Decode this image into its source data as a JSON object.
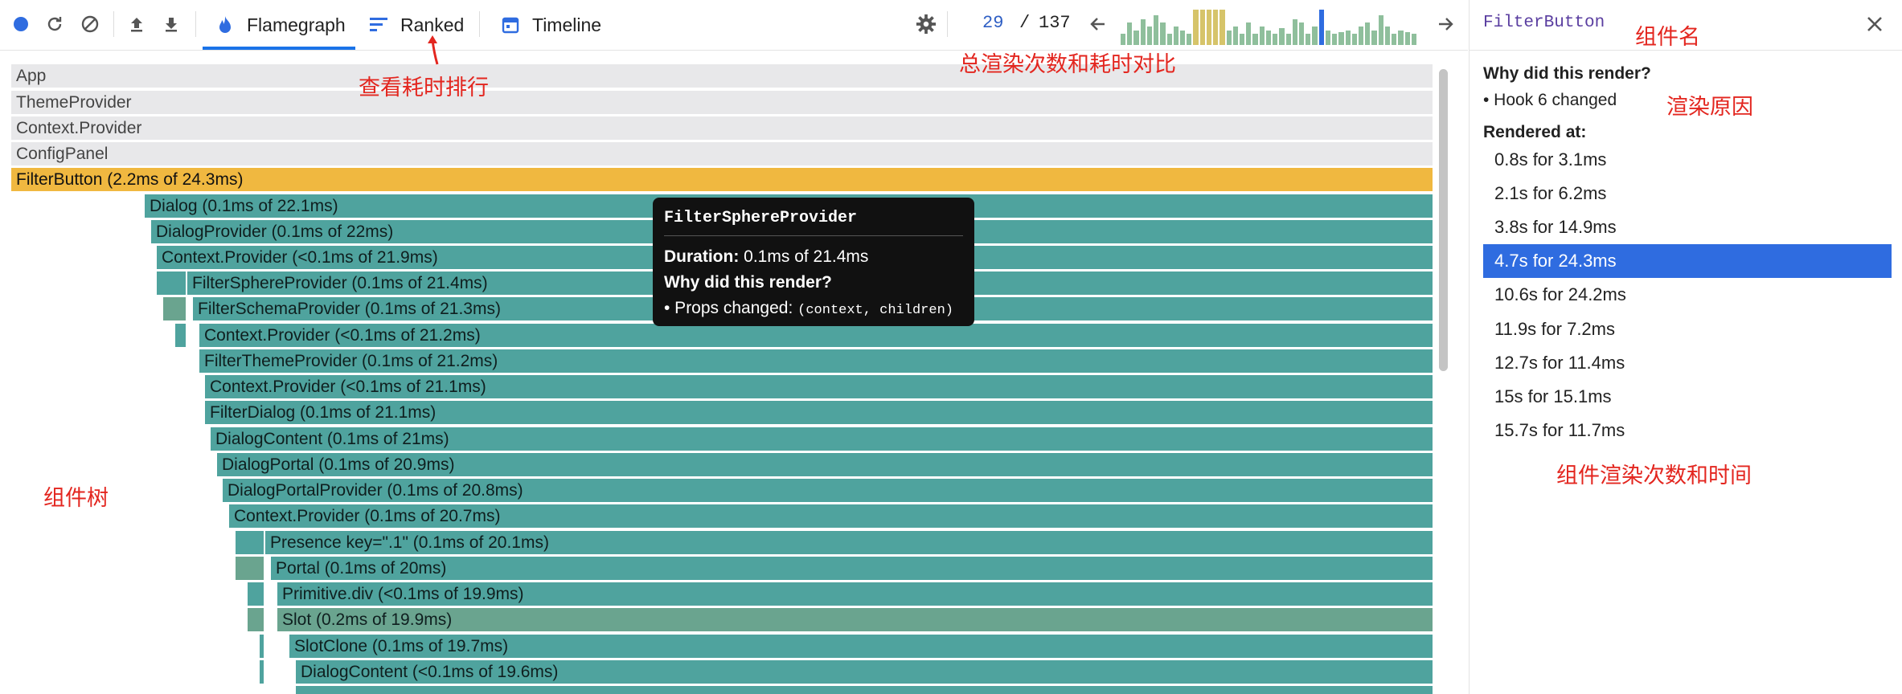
{
  "toolbar": {
    "icons": [
      "record-icon",
      "reload-icon",
      "clear-icon",
      "upload-icon",
      "download-icon"
    ],
    "tabs": [
      {
        "label": "Flamegraph",
        "icon": "flame-icon",
        "active": true
      },
      {
        "label": "Ranked",
        "icon": "ranked-icon",
        "active": false
      },
      {
        "label": "Timeline",
        "icon": "calendar-icon",
        "active": false
      }
    ],
    "settings_icon": "gear-icon",
    "commit_current": "29",
    "commit_separator": "/",
    "commit_total": "137",
    "prev_icon": "arrow-left-icon",
    "next_icon": "arrow-right-icon",
    "commit_heights": [
      0.3,
      0.6,
      0.4,
      0.7,
      0.5,
      0.8,
      0.6,
      0.3,
      0.5,
      0.4,
      0.3,
      0.95,
      0.95,
      0.95,
      0.95,
      0.95,
      0.4,
      0.5,
      0.3,
      0.6,
      0.3,
      0.5,
      0.4,
      0.3,
      0.45,
      0.3,
      0.7,
      0.6,
      0.3,
      0.5,
      0.95,
      0.4,
      0.3,
      0.35,
      0.4,
      0.3,
      0.5,
      0.6,
      0.4,
      0.8,
      0.5,
      0.3,
      0.4,
      0.35,
      0.3
    ],
    "commit_colors": {
      "normal": "#8fbf9c",
      "hot": "#d6c46a",
      "selected": "#2f6ce0"
    }
  },
  "flamegraph": {
    "rows": [
      {
        "label": "App",
        "style": "grey"
      },
      {
        "label": "ThemeProvider",
        "style": "grey"
      },
      {
        "label": "Context.Provider",
        "style": "grey"
      },
      {
        "label": "ConfigPanel",
        "style": "grey"
      },
      {
        "label": "FilterButton (2.2ms of 24.3ms)",
        "style": "sel"
      },
      {
        "label": "Dialog (0.1ms of 22.1ms)",
        "style": "teal"
      },
      {
        "label": "DialogProvider (0.1ms of 22ms)",
        "style": "teal"
      },
      {
        "label": "Context.Provider (<0.1ms of 21.9ms)",
        "style": "teal"
      },
      {
        "label": "FilterSphereProvider (0.1ms of 21.4ms)",
        "style": "teal"
      },
      {
        "label": "FilterSchemaProvider (0.1ms of 21.3ms)",
        "style": "teal"
      },
      {
        "label": "Context.Provider (<0.1ms of 21.2ms)",
        "style": "teal"
      },
      {
        "label": "FilterThemeProvider (0.1ms of 21.2ms)",
        "style": "teal"
      },
      {
        "label": "Context.Provider (<0.1ms of 21.1ms)",
        "style": "teal"
      },
      {
        "label": "FilterDialog (0.1ms of 21.1ms)",
        "style": "teal"
      },
      {
        "label": "DialogContent (0.1ms of 21ms)",
        "style": "teal"
      },
      {
        "label": "DialogPortal (0.1ms of 20.9ms)",
        "style": "teal"
      },
      {
        "label": "DialogPortalProvider (0.1ms of 20.8ms)",
        "style": "teal"
      },
      {
        "label": "Context.Provider (0.1ms of 20.7ms)",
        "style": "teal"
      },
      {
        "label": "Presence key=\".1\" (0.1ms of 20.1ms)",
        "style": "teal"
      },
      {
        "label": "Portal (0.1ms of 20ms)",
        "style": "teal"
      },
      {
        "label": "Primitive.div (<0.1ms of 19.9ms)",
        "style": "teal"
      },
      {
        "label": "Slot (0.2ms of 19.9ms)",
        "style": "teal2"
      },
      {
        "label": "SlotClone (0.1ms of 19.7ms)",
        "style": "teal"
      },
      {
        "label": "DialogContent (<0.1ms of 19.6ms)",
        "style": "teal"
      }
    ],
    "tooltip": {
      "title": "FilterSphereProvider",
      "duration_label": "Duration:",
      "duration_value": "0.1ms of 21.4ms",
      "why_label": "Why did this render?",
      "reason_prefix": "• Props changed:",
      "reason_props": "(context, children)"
    }
  },
  "panel": {
    "title": "FilterButton",
    "close_icon": "close-icon",
    "why_heading": "Why did this render?",
    "reason": "• Hook 6 changed",
    "rendered_heading": "Rendered at:",
    "commits": [
      {
        "label": "0.8s for 3.1ms",
        "selected": false
      },
      {
        "label": "2.1s for 6.2ms",
        "selected": false
      },
      {
        "label": "3.8s for 14.9ms",
        "selected": false
      },
      {
        "label": "4.7s for 24.3ms",
        "selected": true
      },
      {
        "label": "10.6s for 24.2ms",
        "selected": false
      },
      {
        "label": "11.9s for 7.2ms",
        "selected": false
      },
      {
        "label": "12.7s for 11.4ms",
        "selected": false
      },
      {
        "label": "15s for 15.1ms",
        "selected": false
      },
      {
        "label": "15.7s for 11.7ms",
        "selected": false
      }
    ]
  },
  "annotations": {
    "ranked_hint": "查看耗时排行",
    "commits_hint": "总渲染次数和耗时对比",
    "component_name": "组件名",
    "render_reason": "渲染原因",
    "tree": "组件树",
    "render_times": "组件渲染次数和时间"
  }
}
